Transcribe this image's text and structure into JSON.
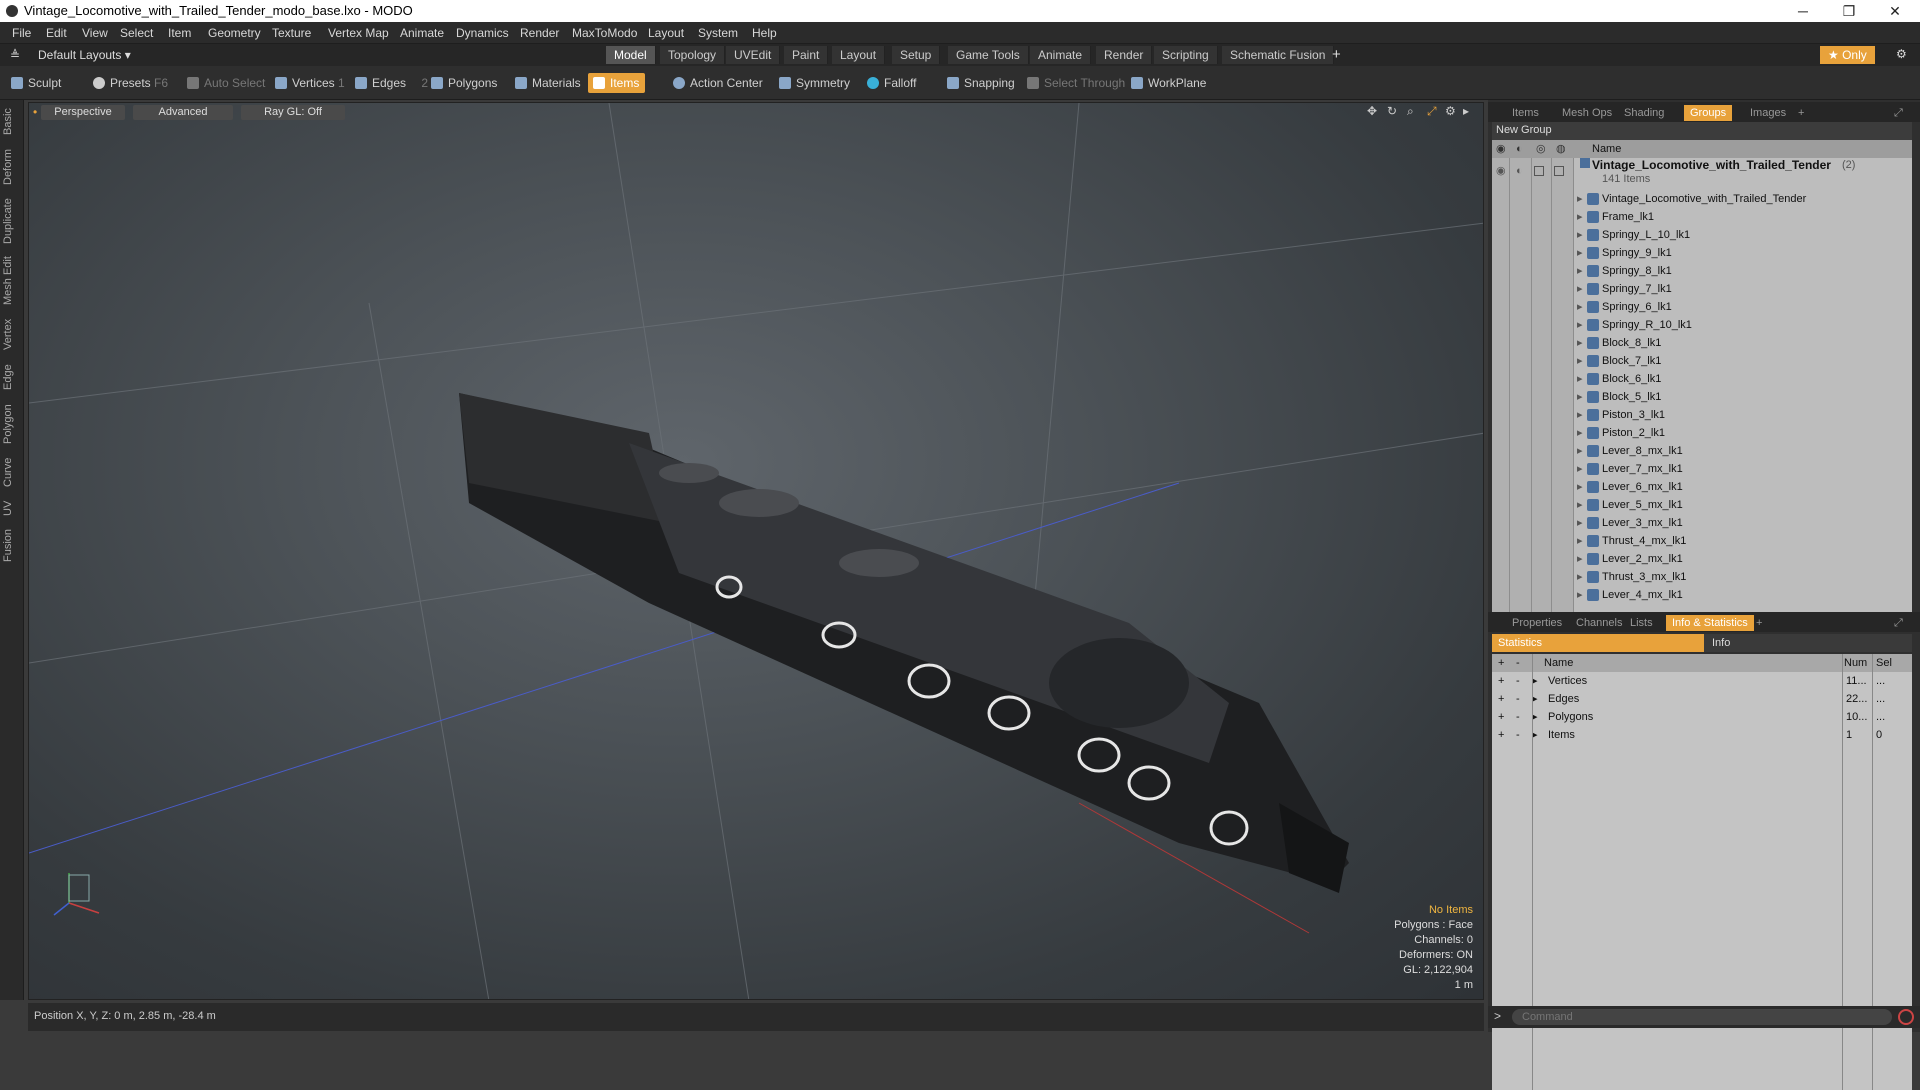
{
  "window": {
    "title": "Vintage_Locomotive_with_Trailed_Tender_modo_base.lxo - MODO"
  },
  "menu": [
    "File",
    "Edit",
    "View",
    "Select",
    "Item",
    "Geometry",
    "Texture",
    "Vertex Map",
    "Animate",
    "Dynamics",
    "Render",
    "MaxToModo",
    "Layout",
    "System",
    "Help"
  ],
  "layout_select": "Default Layouts ▾",
  "tabs": [
    "Model",
    "Topology",
    "UVEdit",
    "Paint",
    "Layout",
    "Setup",
    "Game Tools",
    "Animate",
    "Render",
    "Scripting",
    "Schematic Fusion"
  ],
  "only_label": "★ Only",
  "toolbar": {
    "sculpt": "Sculpt",
    "presets": "Presets",
    "presets_key": "F6",
    "auto_select": "Auto Select",
    "vertices": "Vertices",
    "vertices_num": "1",
    "edges": "Edges",
    "edges_num": "2",
    "polygons": "Polygons",
    "materials": "Materials",
    "items": "Items",
    "action_center": "Action Center",
    "symmetry": "Symmetry",
    "falloff": "Falloff",
    "snapping": "Snapping",
    "select_through": "Select Through",
    "workplane": "WorkPlane"
  },
  "left_tabs": [
    "Basic",
    "Deform",
    "Duplicate",
    "Mesh Edit",
    "Vertex",
    "Edge",
    "Polygon",
    "Curve",
    "UV",
    "Fusion"
  ],
  "viewport": {
    "perspective": "Perspective",
    "advanced": "Advanced",
    "raygl": "Ray GL: Off",
    "info": {
      "no_items": "No Items",
      "polygons": "Polygons : Face",
      "channels": "Channels: 0",
      "deformers": "Deformers: ON",
      "gl": "GL: 2,122,904",
      "scale": "1 m"
    }
  },
  "status": "Position X, Y, Z:  0 m, 2.85 m, -28.4 m",
  "top_panel_tabs": [
    "Items",
    "Mesh Ops",
    "Shading",
    "Groups",
    "Images"
  ],
  "new_group": "New Group",
  "tree_header": "Name",
  "tree": {
    "root": "Vintage_Locomotive_with_Trailed_Tender",
    "root_count": "(2)",
    "root_sub": "141 Items",
    "items": [
      "Vintage_Locomotive_with_Trailed_Tender",
      "Frame_lk1",
      "Springy_L_10_lk1",
      "Springy_9_lk1",
      "Springy_8_lk1",
      "Springy_7_lk1",
      "Springy_6_lk1",
      "Springy_R_10_lk1",
      "Block_8_lk1",
      "Block_7_lk1",
      "Block_6_lk1",
      "Block_5_lk1",
      "Piston_3_lk1",
      "Piston_2_lk1",
      "Lever_8_mx_lk1",
      "Lever_7_mx_lk1",
      "Lever_6_mx_lk1",
      "Lever_5_mx_lk1",
      "Lever_3_mx_lk1",
      "Thrust_4_mx_lk1",
      "Lever_2_mx_lk1",
      "Thrust_3_mx_lk1",
      "Lever_4_mx_lk1"
    ]
  },
  "bottom_panel_tabs": [
    "Properties",
    "Channels",
    "Lists",
    "Info & Statistics"
  ],
  "stats_tabs": {
    "statistics": "Statistics",
    "info": "Info"
  },
  "stats_header": {
    "name": "Name",
    "num": "Num",
    "sel": "Sel"
  },
  "stats": [
    {
      "name": "Vertices",
      "num": "11...",
      "sel": "..."
    },
    {
      "name": "Edges",
      "num": "22...",
      "sel": "..."
    },
    {
      "name": "Polygons",
      "num": "10...",
      "sel": "..."
    },
    {
      "name": "Items",
      "num": "1",
      "sel": "0"
    }
  ],
  "command_placeholder": "Command"
}
